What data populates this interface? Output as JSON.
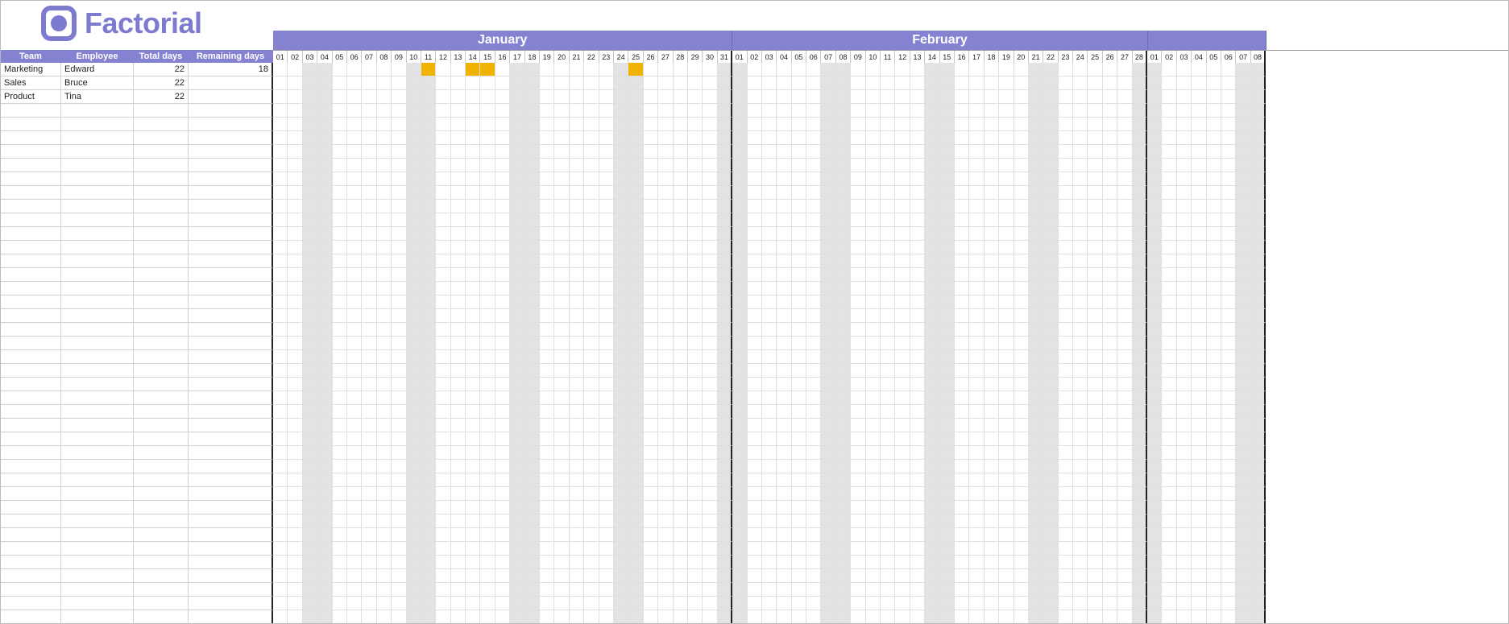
{
  "brand": {
    "name": "Factorial"
  },
  "colors": {
    "purple": "#8583d1",
    "weekend": "#e3e3e3",
    "absence": "#f0b400"
  },
  "left_headers": [
    "Team",
    "Employee",
    "Total days",
    "Remaining days"
  ],
  "months": [
    {
      "name": "January",
      "days": 31,
      "first_weekday": 3
    },
    {
      "name": "February",
      "days": 28,
      "first_weekday": 6
    },
    {
      "name": "",
      "days": 8,
      "first_weekday": 6
    }
  ],
  "employees": [
    {
      "team": "Marketing",
      "name": "Edward",
      "total_days": 22,
      "remaining_days": 18,
      "absences": [
        {
          "month": 0,
          "days": [
            11
          ]
        },
        {
          "month": 0,
          "days": [
            14,
            15
          ]
        },
        {
          "month": 0,
          "days": [
            25
          ]
        }
      ]
    },
    {
      "team": "Sales",
      "name": "Bruce",
      "total_days": 22,
      "remaining_days": "",
      "absences": []
    },
    {
      "team": "Product",
      "name": "Tina",
      "total_days": 22,
      "remaining_days": "",
      "absences": []
    }
  ],
  "empty_rows": 38
}
